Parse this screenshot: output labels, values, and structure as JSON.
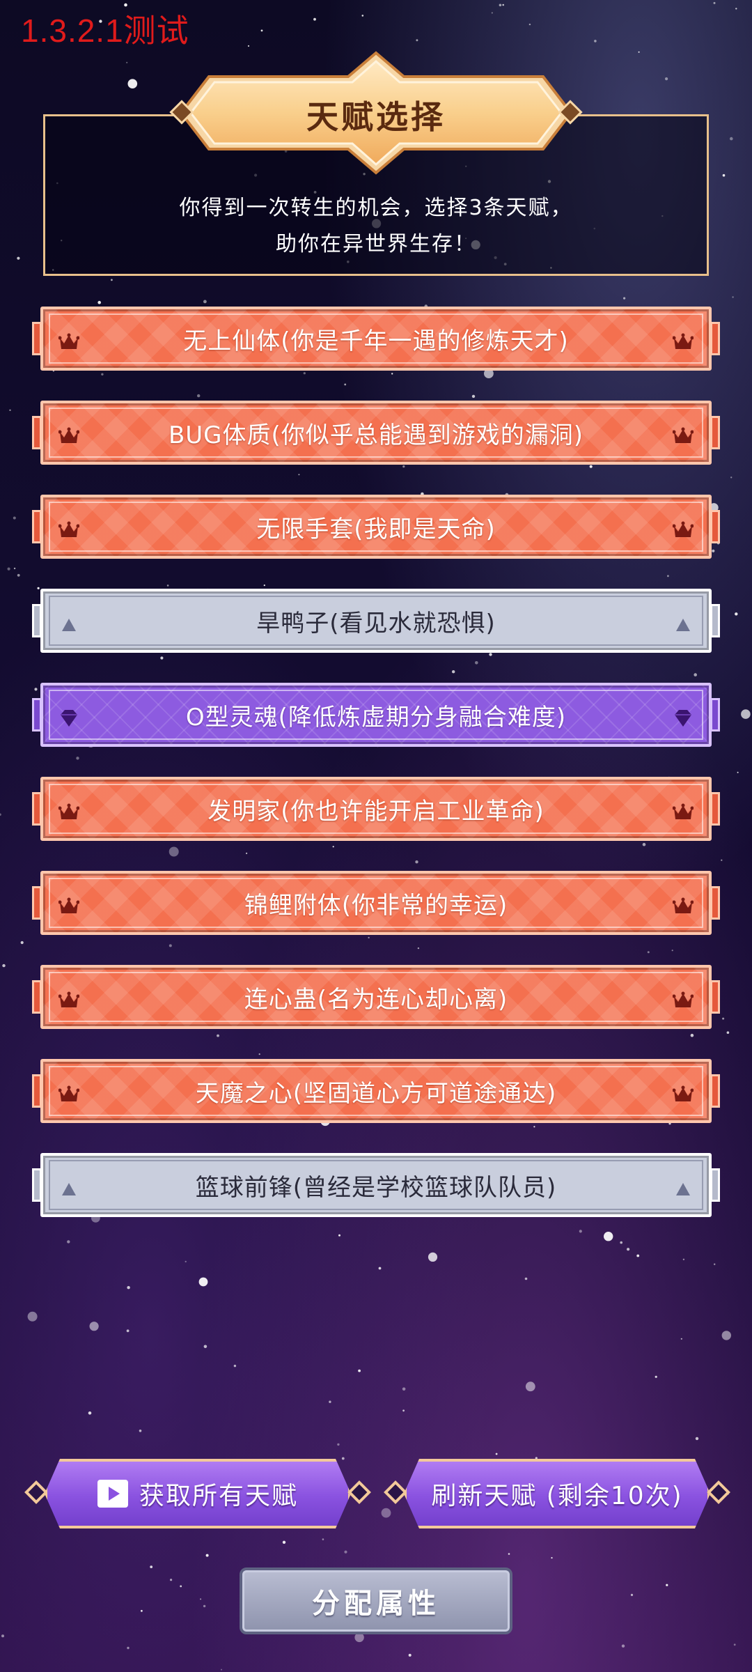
{
  "version_label": "1.3.2.1测试",
  "header": {
    "title": "天赋选择",
    "intro_line1": "你得到一次转生的机会，选择3条天赋，",
    "intro_line2": "助你在异世界生存！"
  },
  "talents": [
    {
      "label": "无上仙体(你是千年一遇的修炼天才)",
      "rarity": "orange",
      "icon": "crown-icon"
    },
    {
      "label": "BUG体质(你似乎总能遇到游戏的漏洞)",
      "rarity": "orange",
      "icon": "crown-icon"
    },
    {
      "label": "无限手套(我即是天命)",
      "rarity": "orange",
      "icon": "crown-icon"
    },
    {
      "label": "旱鸭子(看见水就恐惧)",
      "rarity": "gray",
      "icon": "triangle-icon"
    },
    {
      "label": "O型灵魂(降低炼虚期分身融合难度)",
      "rarity": "purple",
      "icon": "gem-icon"
    },
    {
      "label": "发明家(你也许能开启工业革命)",
      "rarity": "orange",
      "icon": "crown-icon"
    },
    {
      "label": "锦鲤附体(你非常的幸运)",
      "rarity": "orange",
      "icon": "crown-icon"
    },
    {
      "label": "连心蛊(名为连心却心离)",
      "rarity": "orange",
      "icon": "crown-icon"
    },
    {
      "label": "天魔之心(坚固道心方可道途通达)",
      "rarity": "orange",
      "icon": "crown-icon"
    },
    {
      "label": "篮球前锋(曾经是学校篮球队队员)",
      "rarity": "gray",
      "icon": "triangle-icon"
    }
  ],
  "buttons": {
    "get_all": "获取所有天赋",
    "refresh": "刷新天赋 (剩余10次)",
    "allocate": "分配属性"
  },
  "colors": {
    "orange": "#f4704f",
    "purple": "#8d5be0",
    "gray": "#c9cedd",
    "gold_border": "#e8c08b"
  }
}
